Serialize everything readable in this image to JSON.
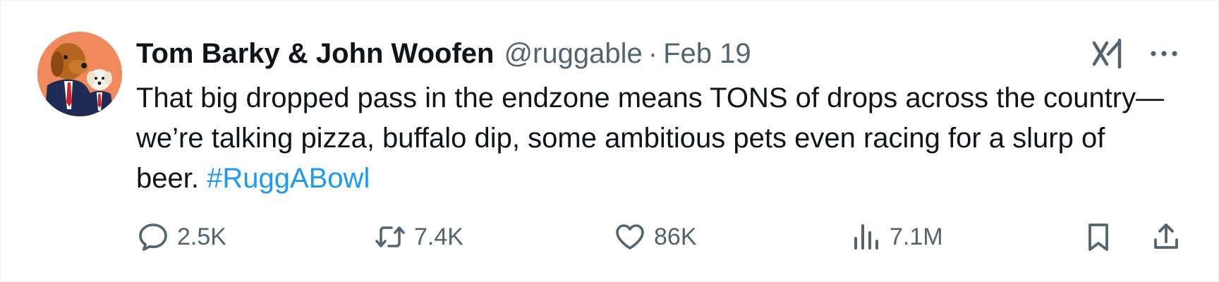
{
  "tweet": {
    "author_name": "Tom Barky & John Woofen",
    "handle": "@ruggable",
    "separator": "·",
    "date": "Feb 19",
    "text": "That big dropped pass in the endzone means TONS of drops across the country—we’re talking pizza, buffalo dip, some ambitious pets even racing for a slurp of beer. ",
    "hashtag": "#RuggABowl"
  },
  "avatar": {
    "name": "dogs-in-suits-avatar"
  },
  "icons": {
    "grok": "grok-icon",
    "more": "more-options-icon",
    "reply": "reply-icon",
    "retweet": "retweet-icon",
    "like": "heart-icon",
    "views": "views-chart-icon",
    "bookmark": "bookmark-icon",
    "share": "share-icon"
  },
  "actions": {
    "replies": "2.5K",
    "retweets": "7.4K",
    "likes": "86K",
    "views": "7.1M"
  },
  "colors": {
    "text": "#0f1419",
    "muted": "#536471",
    "link": "#1d9bf0",
    "avatar_bg": "#f08a5d"
  }
}
